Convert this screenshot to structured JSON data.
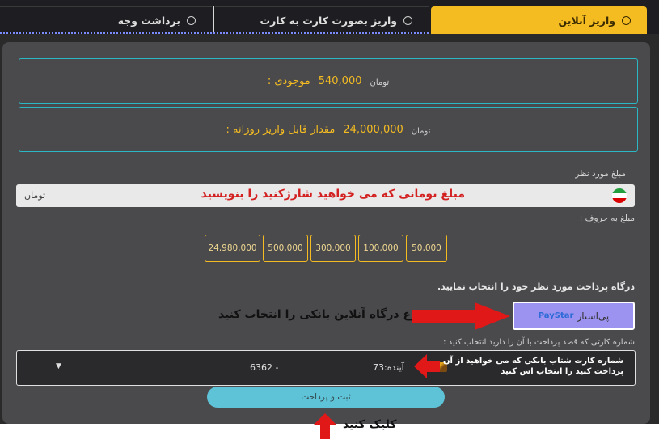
{
  "tabs": [
    {
      "label": "واریز آنلاین",
      "active": true
    },
    {
      "label": "واریز بصورت کارت به کارت",
      "active": false
    },
    {
      "label": "برداشت وجه",
      "active": false
    }
  ],
  "balance": {
    "label": "موجودی :",
    "value": "540,000",
    "unit": "تومان"
  },
  "daily_limit": {
    "label": "مقدار قابل واریز روزانه :",
    "value": "24,000,000",
    "unit": "تومان"
  },
  "amount_field": {
    "label": "مبلغ مورد نظر",
    "unit": "تومان",
    "hint": "مبلغ تومانی که می خواهید شارژکنید را بنویسید",
    "words_label": "مبلغ به حروف :"
  },
  "presets": [
    "50,000",
    "100,000",
    "300,000",
    "500,000",
    "24,980,000"
  ],
  "gateway": {
    "title": "درگاه پرداخت مورد نظر خود را انتخاب نمایید.",
    "option_label": "پی‌استار",
    "logo_text": "PayStar"
  },
  "card": {
    "label": "شماره کارتی که قصد پرداخت با آن را دارید انتخاب کنید :",
    "bank": "آینده:73",
    "number": "6362 -"
  },
  "submit_label": "ثبت و پرداخت",
  "annotations": {
    "amount_hint": "مبلغ تومانی که می خواهید شارژکنید را بنویسید",
    "gateway_hint": "نوع درگاه آنلاین بانکی را انتخاب کنید",
    "card_hint_line1": "شماره کارت شتاب بانکی که می خواهید از آن",
    "card_hint_line2": "پرداخت کنید را انتخاب اش کنید",
    "click_hint": "کلیک کنید"
  },
  "colors": {
    "accent": "#f5bc21",
    "border_cyan": "#2bb7c4",
    "arrow_red": "#e01818",
    "gateway_bg": "#9c93f0",
    "submit_bg": "#5ec3d6"
  }
}
